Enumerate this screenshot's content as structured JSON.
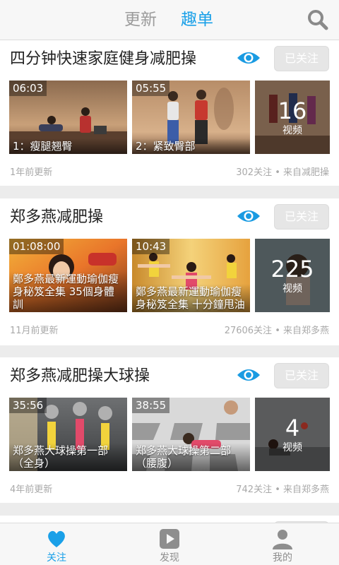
{
  "header": {
    "tab_updates": "更新",
    "tab_lists": "趣单",
    "search_icon": "search-icon",
    "accent": "#1aa0e8"
  },
  "cards": [
    {
      "title": "四分钟快速家庭健身减肥操",
      "follow_label": "已关注",
      "videos": [
        {
          "duration": "06:03",
          "caption": "1：瘦腿翘臀"
        },
        {
          "duration": "05:55",
          "caption": "2：紧致臀部"
        }
      ],
      "count": "16",
      "count_label": "视频",
      "updated": "1年前更新",
      "stats": "302关注 • 来自减肥操"
    },
    {
      "title": "郑多燕减肥操",
      "follow_label": "已关注",
      "videos": [
        {
          "duration": "01:08:00",
          "caption": "鄭多燕最新運動瑜伽瘦身秘笈全集 35個身體訓"
        },
        {
          "duration": "10:43",
          "caption": "鄭多燕最新運動瑜伽瘦身秘笈全集 十分鐘甩油"
        }
      ],
      "count": "225",
      "count_label": "视频",
      "updated": "11月前更新",
      "stats": "27606关注 • 来自郑多燕"
    },
    {
      "title": "郑多燕减肥操大球操",
      "follow_label": "已关注",
      "videos": [
        {
          "duration": "35:56",
          "caption": "郑多燕大球操第一部（全身）"
        },
        {
          "duration": "38:55",
          "caption": "郑多燕大球操第二部（腰腹）"
        }
      ],
      "count": "4",
      "count_label": "视频",
      "updated": "4年前更新",
      "stats": "742关注 • 来自郑多燕"
    }
  ],
  "bottom_nav": [
    {
      "label": "关注",
      "icon": "heart-icon",
      "active": true
    },
    {
      "label": "发现",
      "icon": "play-icon",
      "active": false
    },
    {
      "label": "我的",
      "icon": "person-icon",
      "active": false
    }
  ]
}
